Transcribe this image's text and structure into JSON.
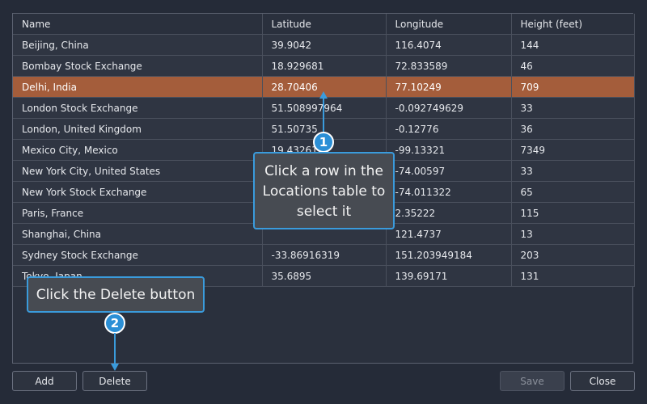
{
  "table": {
    "headers": [
      "Name",
      "Latitude",
      "Longitude",
      "Height (feet)"
    ],
    "rows": [
      [
        "Beijing, China",
        "39.9042",
        "116.4074",
        "144"
      ],
      [
        "Bombay Stock Exchange",
        "18.929681",
        "72.833589",
        "46"
      ],
      [
        "Delhi, India",
        "28.70406",
        "77.10249",
        "709"
      ],
      [
        "London Stock Exchange",
        "51.508997964",
        "-0.092749629",
        "33"
      ],
      [
        "London, United Kingdom",
        "51.50735",
        "-0.12776",
        "36"
      ],
      [
        "Mexico City, Mexico",
        "19.43261",
        "-99.13321",
        "7349"
      ],
      [
        "New York City, United States",
        "",
        "-74.00597",
        "33"
      ],
      [
        "New York Stock Exchange",
        "",
        "-74.011322",
        "65"
      ],
      [
        "Paris, France",
        "",
        "2.35222",
        "115"
      ],
      [
        "Shanghai, China",
        "",
        "121.4737",
        "13"
      ],
      [
        "Sydney Stock Exchange",
        "-33.86916319",
        "151.203949184",
        "203"
      ],
      [
        "Tokyo, Japan",
        "35.6895",
        "139.69171",
        "131"
      ]
    ],
    "selected_row": 2,
    "selected_color": "#a45d3b"
  },
  "buttons": {
    "add": "Add",
    "delete": "Delete",
    "save": "Save",
    "close": "Close"
  },
  "callouts": {
    "step1": {
      "number": "1",
      "text": "Click a row in the Locations table to select it"
    },
    "step2": {
      "number": "2",
      "text": "Click the Delete button"
    }
  }
}
